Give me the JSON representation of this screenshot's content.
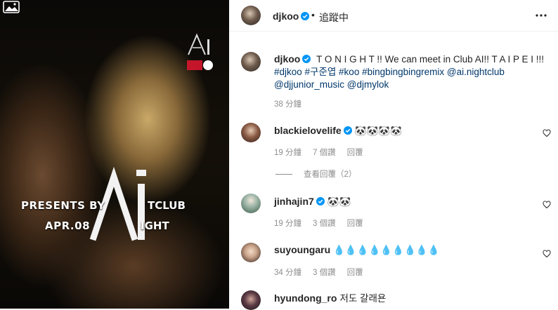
{
  "media": {
    "gallery_icon": "image-gallery-icon",
    "presents_text": "PRESENTS BY",
    "club_suffix": "TCLUB",
    "date_text": "APR.08",
    "night_suffix": "IGHT"
  },
  "header": {
    "username": "djkoo",
    "dot": "•",
    "follow_label": "追蹤中"
  },
  "caption": {
    "username": "djkoo",
    "text": "T O N I G H T !! We can meet in Club AI!! T A I P E I !!!",
    "tags": "#djkoo #구준엽 #koo #bingbingbingremix @ai.nightclub @djjunior_music @djmylok",
    "time": "38 分鐘"
  },
  "comments": [
    {
      "username": "blackielovelife",
      "text": "🐼🐼🐼🐼",
      "time": "19 分鐘",
      "likes": "7 個讚",
      "reply": "回覆",
      "verified": true,
      "view_replies": "查看回覆（2）"
    },
    {
      "username": "jinhajin7",
      "text": "🐼🐼",
      "time": "19 分鐘",
      "likes": "3 個讚",
      "reply": "回覆",
      "verified": true
    },
    {
      "username": "suyoungaru",
      "text": "💧💧💧💧💧💧💧💧💧",
      "time": "34 分鐘",
      "likes": "3 個讚",
      "reply": "回覆",
      "verified": false
    },
    {
      "username": "hyundong_ro",
      "text": "저도 갈래욘",
      "verified": false
    }
  ],
  "colors": {
    "verified": "#0095f6",
    "link": "#00376b",
    "muted": "#8e8e8e"
  }
}
